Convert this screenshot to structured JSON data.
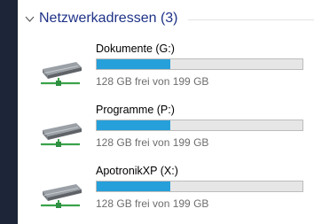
{
  "group": {
    "title": "Netzwerkadressen (3)",
    "icon": "chevron-down-icon"
  },
  "drives": [
    {
      "name": "Dokumente (G:)",
      "free_text": "128 GB frei von 199 GB",
      "used_fraction": 0.357,
      "icon": "network-drive-icon"
    },
    {
      "name": "Programme (P:)",
      "free_text": "128 GB frei von 199 GB",
      "used_fraction": 0.357,
      "icon": "network-drive-icon"
    },
    {
      "name": "ApotronikXP (X:)",
      "free_text": "128 GB frei von 199 GB",
      "used_fraction": 0.357,
      "icon": "network-drive-icon"
    }
  ],
  "colors": {
    "desktop_bg": "#1c2638",
    "header_text": "#1e3287",
    "bar_fill": "#26a0da",
    "bar_track": "#e6e6e6"
  }
}
